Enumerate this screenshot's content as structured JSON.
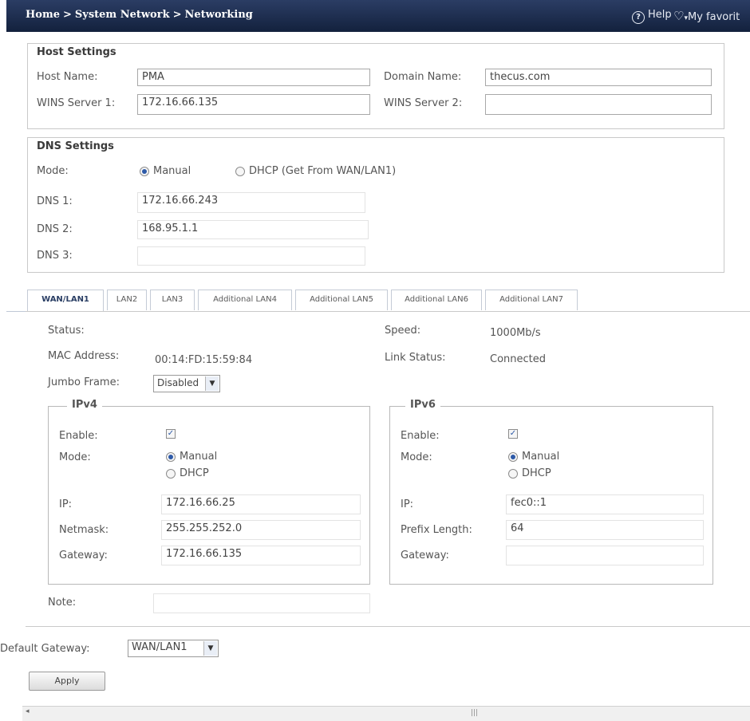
{
  "breadcrumb": [
    "Home",
    "System Network",
    "Networking"
  ],
  "breadcrumb_sep": ">",
  "header": {
    "help": "Help",
    "favorite": "My favorit"
  },
  "host_settings": {
    "title": "Host Settings",
    "host_name_label": "Host Name:",
    "host_name": "PMA",
    "domain_name_label": "Domain Name:",
    "domain_name": "thecus.com",
    "wins1_label": "WINS Server 1:",
    "wins1": "172.16.66.135",
    "wins2_label": "WINS Server 2:",
    "wins2": ""
  },
  "dns_settings": {
    "title": "DNS Settings",
    "mode_label": "Mode:",
    "mode_manual": "Manual",
    "mode_dhcp": "DHCP (Get From WAN/LAN1)",
    "selected_mode": "Manual",
    "dns1_label": "DNS 1:",
    "dns1": "172.16.66.243",
    "dns2_label": "DNS 2:",
    "dns2": "168.95.1.1",
    "dns3_label": "DNS 3:",
    "dns3": ""
  },
  "tabs": [
    "WAN/LAN1",
    "LAN2",
    "LAN3",
    "Additional LAN4",
    "Additional LAN5",
    "Additional LAN6",
    "Additional LAN7"
  ],
  "active_tab": "WAN/LAN1",
  "interface": {
    "status_label": "Status:",
    "status": "",
    "speed_label": "Speed:",
    "speed": "1000Mb/s",
    "mac_label": "MAC Address:",
    "mac": "00:14:FD:15:59:84",
    "link_label": "Link Status:",
    "link": "Connected",
    "jumbo_label": "Jumbo Frame:",
    "jumbo": "Disabled"
  },
  "ipv4": {
    "title": "IPv4",
    "enable_label": "Enable:",
    "enabled": true,
    "mode_label": "Mode:",
    "mode_manual": "Manual",
    "mode_dhcp": "DHCP",
    "selected_mode": "Manual",
    "ip_label": "IP:",
    "ip": "172.16.66.25",
    "netmask_label": "Netmask:",
    "netmask": "255.255.252.0",
    "gateway_label": "Gateway:",
    "gateway": "172.16.66.135"
  },
  "ipv6": {
    "title": "IPv6",
    "enable_label": "Enable:",
    "enabled": true,
    "mode_label": "Mode:",
    "mode_manual": "Manual",
    "mode_dhcp": "DHCP",
    "selected_mode": "Manual",
    "ip_label": "IP:",
    "ip": "fec0::1",
    "prefix_label": "Prefix Length:",
    "prefix": "64",
    "gateway_label": "Gateway:",
    "gateway": ""
  },
  "note_label": "Note:",
  "note": "",
  "default_gateway_label": "Default Gateway:",
  "default_gateway": "WAN/LAN1",
  "apply_label": "Apply",
  "colors": {
    "header_bg": "#1a2a4c",
    "tab_active_text": "#2a3e64",
    "radio_dot": "#2d5aa8"
  }
}
